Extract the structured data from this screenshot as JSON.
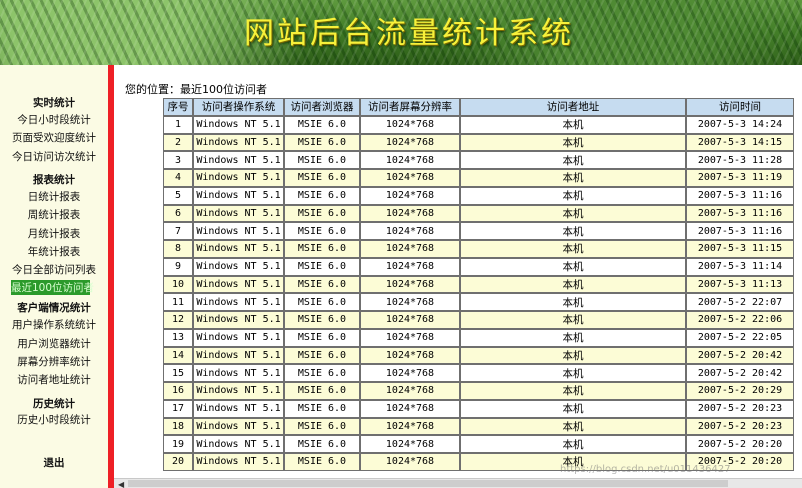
{
  "banner": {
    "title": "网站后台流量统计系统"
  },
  "sidebar": {
    "sections": [
      {
        "title": "实时统计",
        "items": [
          "今日小时段统计",
          "页面受欢迎度统计",
          "今日访问访次统计"
        ]
      },
      {
        "title": "报表统计",
        "items": [
          "日统计报表",
          "周统计报表",
          "月统计报表",
          "年统计报表",
          "今日全部访问列表",
          "最近100位访问者"
        ]
      },
      {
        "title": "客户端情况统计",
        "items": [
          "用户操作系统统计",
          "用户浏览器统计",
          "屏幕分辨率统计",
          "访问者地址统计"
        ]
      },
      {
        "title": "历史统计",
        "items": [
          "历史小时段统计"
        ]
      }
    ],
    "active_item": "最近100位访问者",
    "logout": "退出"
  },
  "breadcrumb": "您的位置：最近100位访问者",
  "table": {
    "headers": [
      "序号",
      "访问者操作系统",
      "访问者浏览器",
      "访问者屏幕分辨率",
      "访问者地址",
      "访问时间"
    ],
    "rows": [
      [
        "1",
        "Windows NT 5.1",
        "MSIE 6.0",
        "1024*768",
        "本机",
        "2007-5-3 14:24"
      ],
      [
        "2",
        "Windows NT 5.1",
        "MSIE 6.0",
        "1024*768",
        "本机",
        "2007-5-3 14:15"
      ],
      [
        "3",
        "Windows NT 5.1",
        "MSIE 6.0",
        "1024*768",
        "本机",
        "2007-5-3 11:28"
      ],
      [
        "4",
        "Windows NT 5.1",
        "MSIE 6.0",
        "1024*768",
        "本机",
        "2007-5-3 11:19"
      ],
      [
        "5",
        "Windows NT 5.1",
        "MSIE 6.0",
        "1024*768",
        "本机",
        "2007-5-3 11:16"
      ],
      [
        "6",
        "Windows NT 5.1",
        "MSIE 6.0",
        "1024*768",
        "本机",
        "2007-5-3 11:16"
      ],
      [
        "7",
        "Windows NT 5.1",
        "MSIE 6.0",
        "1024*768",
        "本机",
        "2007-5-3 11:16"
      ],
      [
        "8",
        "Windows NT 5.1",
        "MSIE 6.0",
        "1024*768",
        "本机",
        "2007-5-3 11:15"
      ],
      [
        "9",
        "Windows NT 5.1",
        "MSIE 6.0",
        "1024*768",
        "本机",
        "2007-5-3 11:14"
      ],
      [
        "10",
        "Windows NT 5.1",
        "MSIE 6.0",
        "1024*768",
        "本机",
        "2007-5-3 11:13"
      ],
      [
        "11",
        "Windows NT 5.1",
        "MSIE 6.0",
        "1024*768",
        "本机",
        "2007-5-2 22:07"
      ],
      [
        "12",
        "Windows NT 5.1",
        "MSIE 6.0",
        "1024*768",
        "本机",
        "2007-5-2 22:06"
      ],
      [
        "13",
        "Windows NT 5.1",
        "MSIE 6.0",
        "1024*768",
        "本机",
        "2007-5-2 22:05"
      ],
      [
        "14",
        "Windows NT 5.1",
        "MSIE 6.0",
        "1024*768",
        "本机",
        "2007-5-2 20:42"
      ],
      [
        "15",
        "Windows NT 5.1",
        "MSIE 6.0",
        "1024*768",
        "本机",
        "2007-5-2 20:42"
      ],
      [
        "16",
        "Windows NT 5.1",
        "MSIE 6.0",
        "1024*768",
        "本机",
        "2007-5-2 20:29"
      ],
      [
        "17",
        "Windows NT 5.1",
        "MSIE 6.0",
        "1024*768",
        "本机",
        "2007-5-2 20:23"
      ],
      [
        "18",
        "Windows NT 5.1",
        "MSIE 6.0",
        "1024*768",
        "本机",
        "2007-5-2 20:23"
      ],
      [
        "19",
        "Windows NT 5.1",
        "MSIE 6.0",
        "1024*768",
        "本机",
        "2007-5-2 20:20"
      ],
      [
        "20",
        "Windows NT 5.1",
        "MSIE 6.0",
        "1024*768",
        "本机",
        "2007-5-2 20:20"
      ]
    ]
  },
  "watermark": "https://blog.csdn.net/u011436427",
  "colors": {
    "title": "#f7f13a",
    "sidebar_bg": "#fbfbe4",
    "divider": "#ee1f25",
    "header_bg": "#c6dcf0",
    "row_alt_bg": "#fcfcd6",
    "active_item_bg": "#2b9a2b"
  },
  "icons": {
    "scroll_left": "triangle-left-icon"
  }
}
